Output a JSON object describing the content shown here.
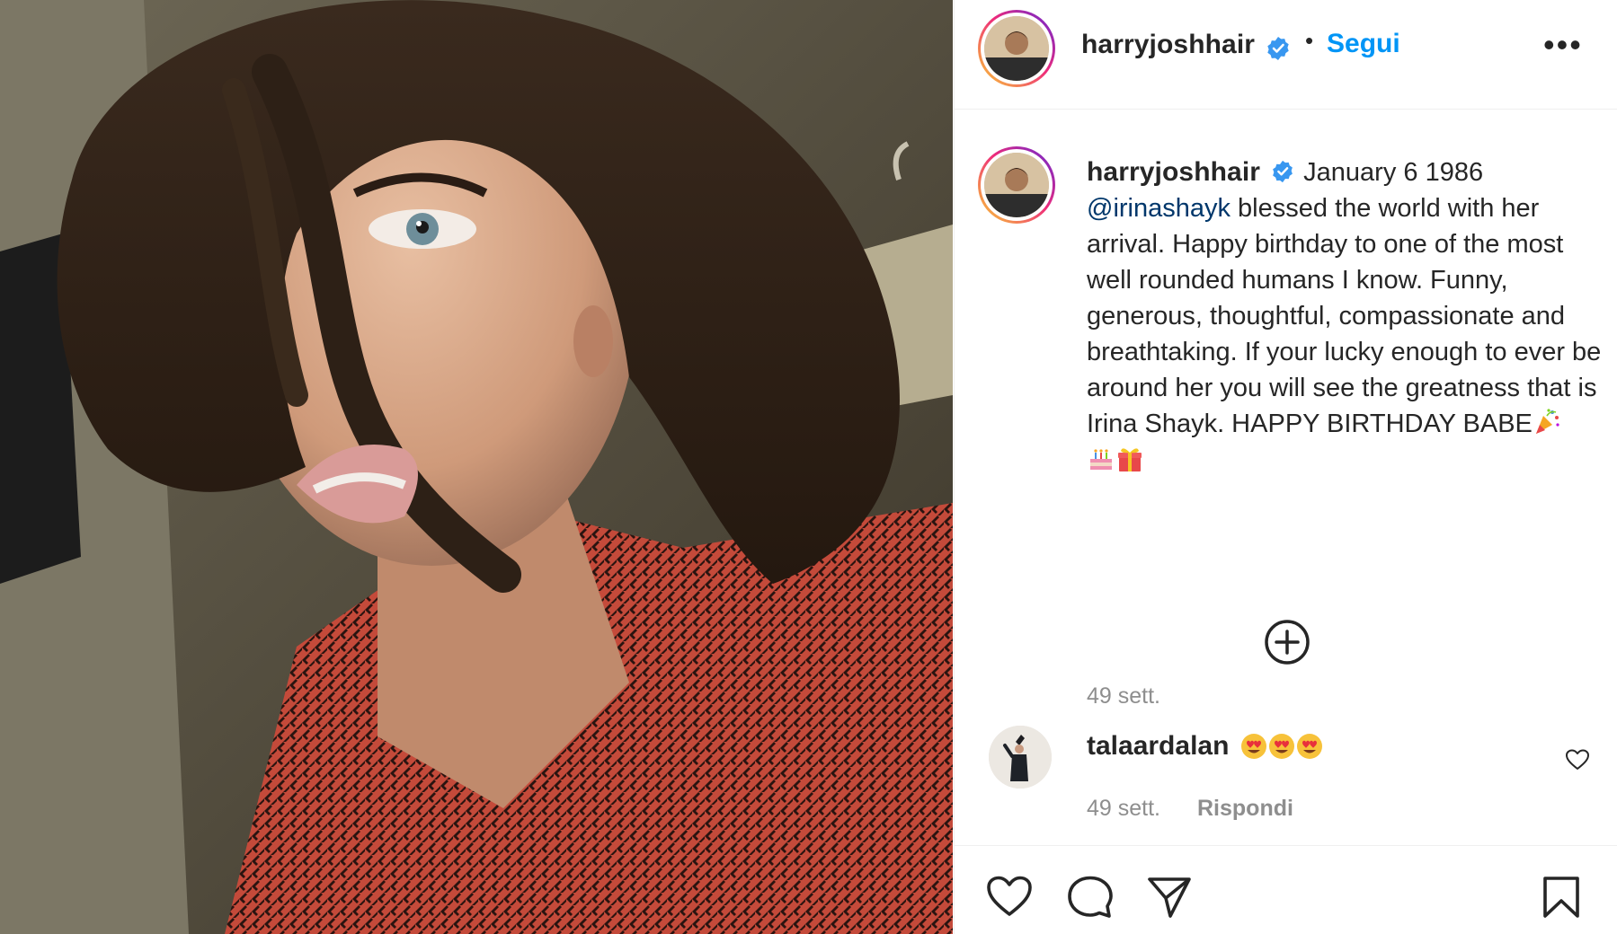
{
  "post": {
    "author": "harryjoshhair",
    "verified": true,
    "follow_label": "Segui",
    "separator": "•",
    "more_label": "•••"
  },
  "caption": {
    "author": "harryjoshhair",
    "text_start": " January 6 1986",
    "mention": "@irinashayk",
    "text_body": " blessed the world with her arrival. Happy birthday to one of the most well rounded humans I know. Funny, generous, thoughtful, compassionate and breathtaking. If your lucky enough to ever be around her you will see the greatness that is Irina Shayk. HAPPY BIRTHDAY BABE",
    "emoji_names": [
      "party-popper",
      "birthday-cake",
      "wrapped-gift"
    ],
    "time": "49 sett."
  },
  "load_more_icon": "plus-circle-icon",
  "comments": [
    {
      "user": "talaardalan",
      "emoji_names": [
        "heart-eyes",
        "heart-eyes",
        "heart-eyes"
      ],
      "time": "49 sett.",
      "reply_label": "Rispondi"
    }
  ],
  "actions": [
    "heart-icon",
    "comment-icon",
    "share-icon",
    "bookmark-icon"
  ],
  "colors": {
    "link": "#0095f6",
    "mention": "#00376b",
    "muted": "#8e8e8e",
    "text": "#262626",
    "verified": "#3897f0"
  }
}
